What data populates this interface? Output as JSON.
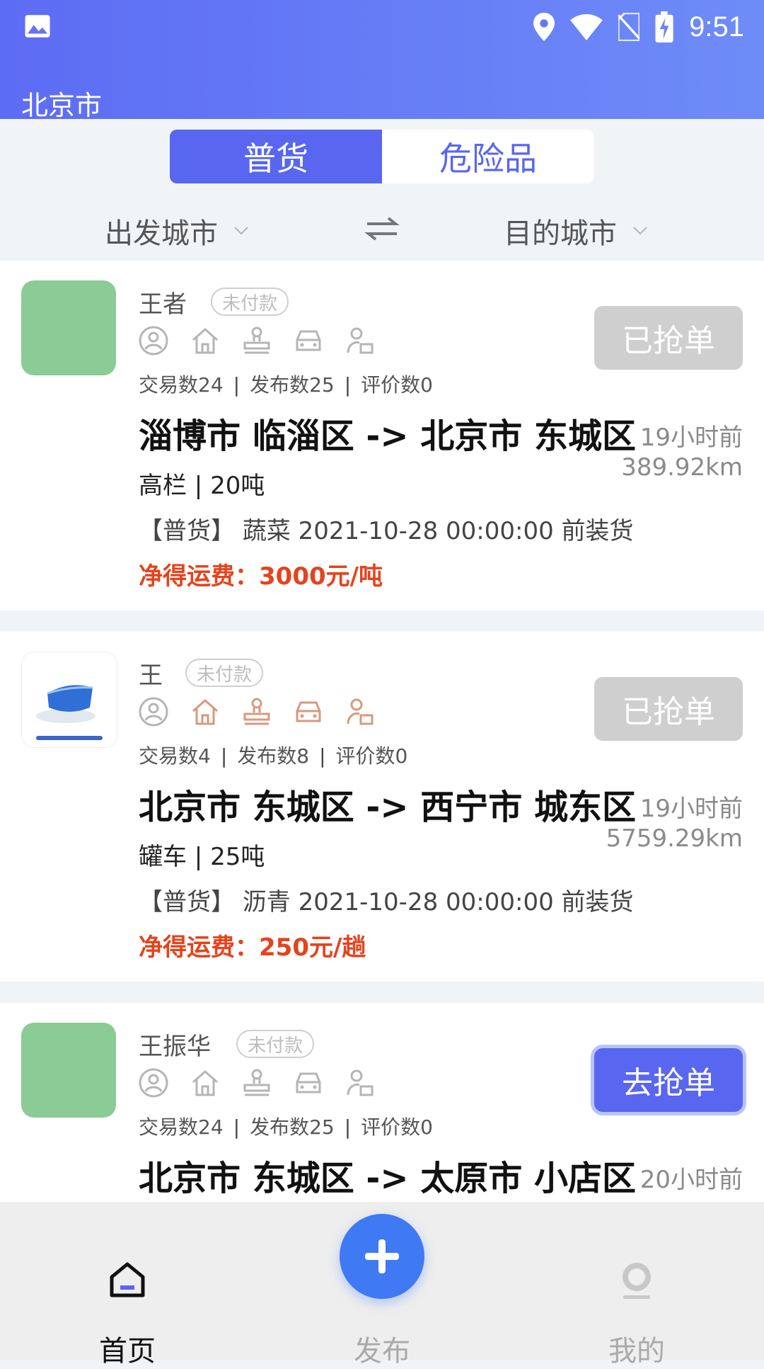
{
  "status_bar": {
    "time": "9:51"
  },
  "header": {
    "city": "北京市"
  },
  "tabs": [
    {
      "label": "普货",
      "active": true
    },
    {
      "label": "危险品",
      "active": false
    }
  ],
  "filters": {
    "from_city": "出发城市",
    "to_city": "目的城市"
  },
  "orders": [
    {
      "name": "王者",
      "badge": "未付款",
      "stats": {
        "trades": "交易数24",
        "published": "发布数25",
        "reviews": "评价数0"
      },
      "button": "已抢单",
      "route": "淄博市 临淄区 -> 北京市 东城区",
      "time_ago": "19小时前",
      "distance": "389.92km",
      "truck": "高栏 | 20吨",
      "goods": "【普货】 蔬菜 2021-10-28 00:00:00 前装货",
      "fee": "净得运费：3000元/吨"
    },
    {
      "name": "王",
      "badge": "未付款",
      "stats": {
        "trades": "交易数4",
        "published": "发布数8",
        "reviews": "评价数0"
      },
      "button": "已抢单",
      "route": "北京市 东城区 -> 西宁市 城东区",
      "time_ago": "19小时前",
      "distance": "5759.29km",
      "truck": "罐车 | 25吨",
      "goods": "【普货】 沥青 2021-10-28 00:00:00 前装货",
      "fee": "净得运费：250元/趟"
    },
    {
      "name": "王振华",
      "badge": "未付款",
      "stats": {
        "trades": "交易数24",
        "published": "发布数25",
        "reviews": "评价数0"
      },
      "button": "去抢单",
      "route": "北京市 东城区 -> 太原市 小店区",
      "time_ago": "20小时前"
    }
  ],
  "nav": {
    "home": "首页",
    "publish": "发布",
    "mine": "我的"
  },
  "colors": {
    "primary": "#5866f0",
    "fee": "#e5431d",
    "avatar_bg": "#8acb96"
  }
}
